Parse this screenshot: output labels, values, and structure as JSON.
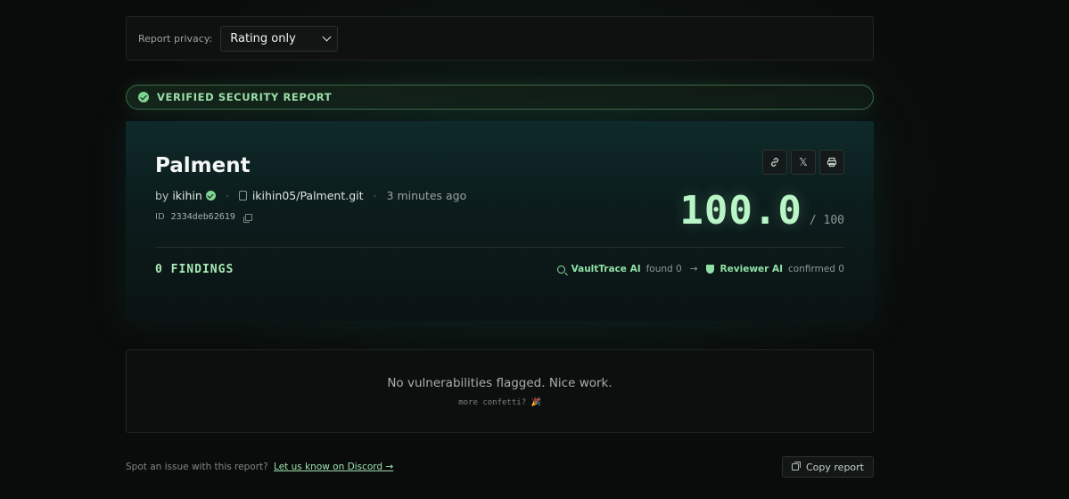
{
  "privacy": {
    "label": "Report privacy:",
    "selected": "Rating only"
  },
  "verified": {
    "label": "VERIFIED SECURITY REPORT"
  },
  "report": {
    "title": "Palment",
    "by_prefix": "by",
    "author": "ikihin",
    "separator": "·",
    "repo": "ikihin05/Palment.git",
    "time": "3 minutes ago",
    "id_label": "ID",
    "id_value": "2334deb62619",
    "score": "100.0",
    "score_max": "/ 100",
    "findings": "0 FINDINGS",
    "pipeline": {
      "scanner_name": "VaultTrace AI",
      "scanner_stat": "found 0",
      "arrow": "→",
      "reviewer_name": "Reviewer AI",
      "reviewer_stat": "confirmed 0"
    },
    "actions": {
      "link_icon": "link-icon",
      "x_label": "𝕏",
      "print_icon": "print-icon"
    }
  },
  "empty": {
    "message": "No vulnerabilities flagged. Nice work.",
    "confetti": "more confetti? 🎉"
  },
  "footer": {
    "text": "Spot an issue with this report?",
    "link": "Let us know on Discord →",
    "copy_button": "Copy report"
  },
  "colors": {
    "accent": "#9fe2ad",
    "score": "#b9f5c6",
    "background": "#0a0c0b"
  }
}
